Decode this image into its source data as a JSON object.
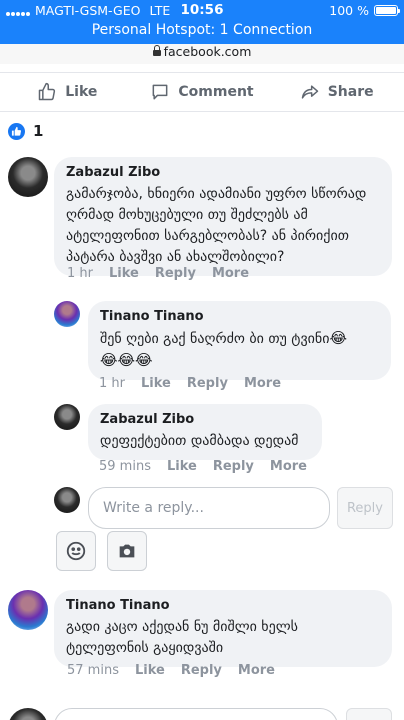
{
  "status_bar": {
    "carrier": "MAGTI-GSM-GEO",
    "network": "LTE",
    "time": "10:56",
    "battery": "100 %",
    "battery_level": 1.0,
    "hotspot": "Personal Hotspot: 1 Connection"
  },
  "url_bar": {
    "domain": "facebook.com"
  },
  "post_actions": {
    "like": "Like",
    "comment": "Comment",
    "share": "Share"
  },
  "reactions": {
    "count": "1"
  },
  "comments": [
    {
      "author": "Zabazul Zibo",
      "text": "გამარჯობა, ხნიერი ადამიანი უფრო სწორად ღრმად მოხუცებული თუ შეძლებს ამ ატელეფონით სარგებლობას? ან პირიქით პატარა ბავშვი ან ახალშობილი?",
      "time": "1 hr",
      "like": "Like",
      "reply": "Reply",
      "more": "More"
    },
    {
      "author": "Tinano Tinano",
      "text": "შენ ღები გაქ ნაღრძო ბი თუ ტვინი",
      "emoji": "😂",
      "emoji_line": "😂😂😂",
      "time": "1 hr",
      "like": "Like",
      "reply": "Reply",
      "more": "More"
    },
    {
      "author": "Zabazul Zibo",
      "text": "დეფექტებით დამბადა დედამ",
      "time": "59 mins",
      "like": "Like",
      "reply": "Reply",
      "more": "More"
    },
    {
      "author": "Tinano Tinano",
      "text": "გადი კაცო აქედან ნუ მიშლი ხელს ტელეფონის გაყიდვაში",
      "time": "57 mins",
      "like": "Like",
      "reply": "Reply",
      "more": "More"
    }
  ],
  "reply_box": {
    "placeholder": "Write a reply...",
    "button": "Reply"
  },
  "colors": {
    "accent": "#1877f2",
    "status_bar": "#1a82fb",
    "bubble": "#f0f2f5",
    "meta_text": "#8d949e"
  }
}
